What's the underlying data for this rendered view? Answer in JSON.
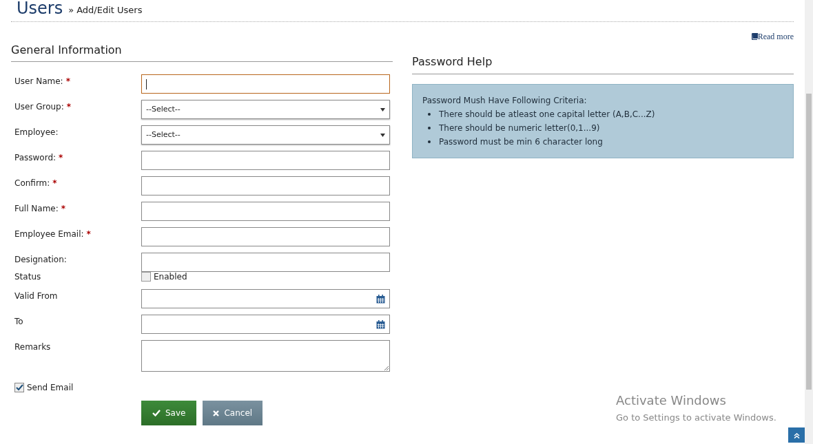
{
  "header": {
    "title": "Users",
    "breadcrumb_separator": "»",
    "breadcrumb": "Add/Edit Users"
  },
  "read_more": "Read more",
  "general": {
    "title": "General Information",
    "fields": [
      {
        "kind": "text",
        "label": "User Name:",
        "required_mark": "*",
        "focused": true
      },
      {
        "kind": "select",
        "label": "User Group:",
        "required_mark": "*",
        "value": "--Select--",
        "focused": false
      },
      {
        "kind": "select",
        "label": "Employee:",
        "value": "--Select--",
        "focused": false
      },
      {
        "kind": "text",
        "label": "Password:",
        "required_mark": "*",
        "focused": false
      },
      {
        "kind": "text",
        "label": "Confirm:",
        "required_mark": "*",
        "focused": false
      },
      {
        "kind": "text",
        "label": "Full Name:",
        "required_mark": "*",
        "focused": false
      },
      {
        "kind": "text",
        "label": "Employee Email:",
        "required_mark": "*",
        "focused": false
      },
      {
        "kind": "text",
        "label": "Designation:",
        "focused": false
      },
      {
        "kind": "checkbox",
        "label": "Status",
        "option": "Enabled",
        "checked": false
      },
      {
        "kind": "date",
        "label": "Valid From",
        "focused": false
      },
      {
        "kind": "date",
        "label": "To",
        "focused": false
      },
      {
        "kind": "textarea",
        "label": "Remarks",
        "focused": false
      }
    ],
    "send_email": {
      "label": "Send Email",
      "checked": true
    },
    "buttons": [
      {
        "kind": "save",
        "label": "Save"
      },
      {
        "kind": "cancel",
        "label": "Cancel"
      }
    ]
  },
  "password_help": {
    "title": "Password Help",
    "intro": "Password Mush Have Following Criteria:",
    "criteria": [
      "There should be atleast one capital letter (A,B,C...Z)",
      "There should be numeric letter(0,1...9)",
      "Password must be min 6 character long"
    ]
  },
  "os_notice": {
    "title": "Activate Windows",
    "text": "Go to Settings to activate Windows."
  }
}
